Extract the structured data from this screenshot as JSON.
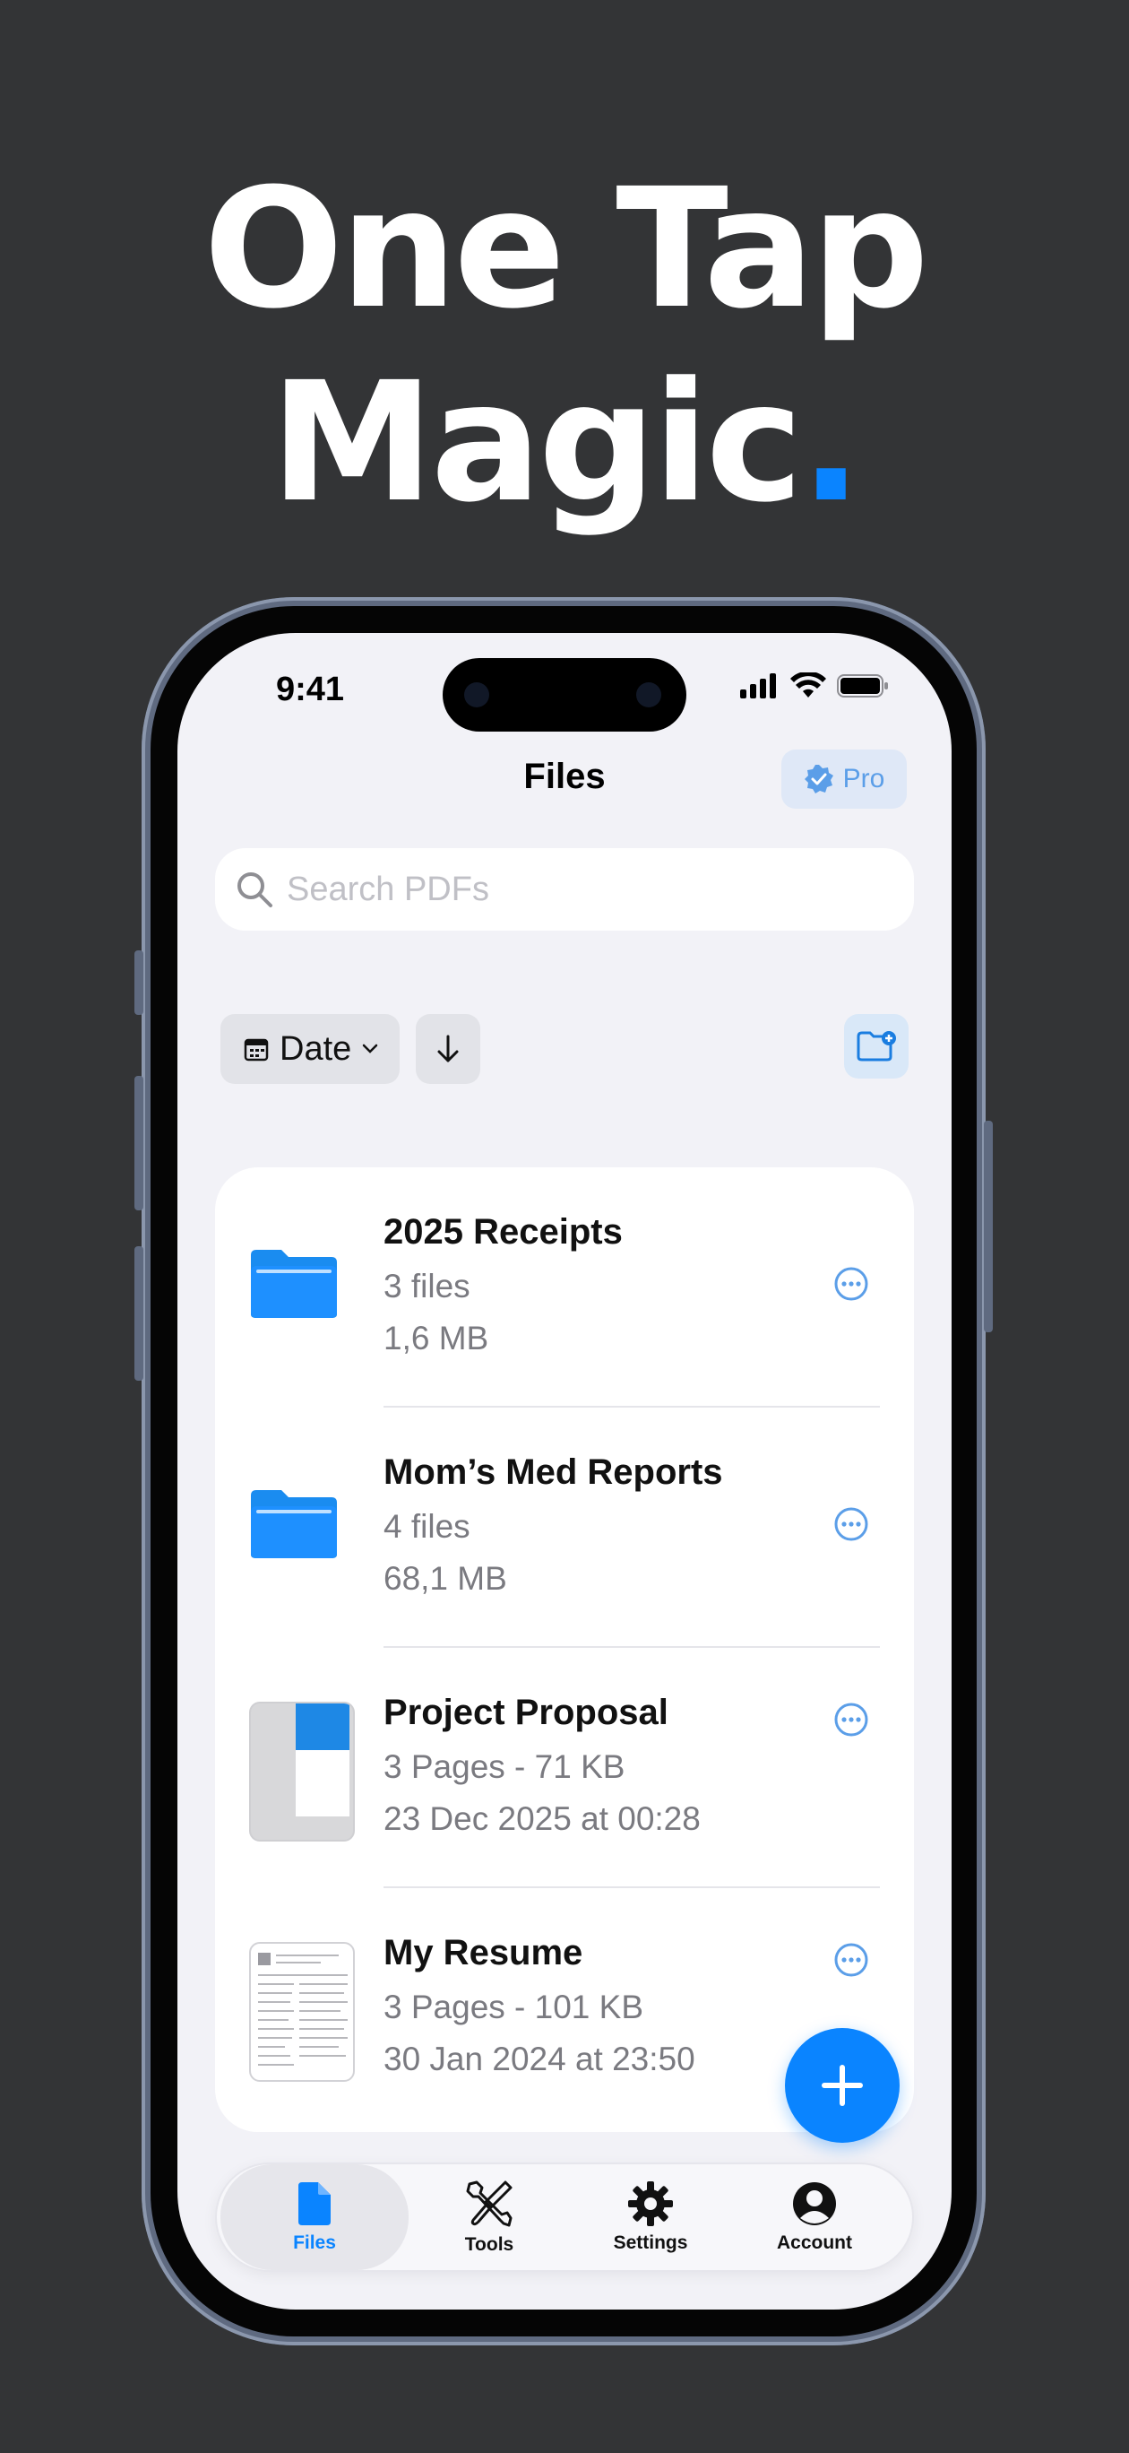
{
  "headline": {
    "line1": "One Tap",
    "line2": "Magic",
    "dot": "."
  },
  "status": {
    "time": "9:41"
  },
  "nav": {
    "title": "Files",
    "pro_label": "Pro"
  },
  "search": {
    "placeholder": "Search PDFs"
  },
  "sort": {
    "label": "Date"
  },
  "files": [
    {
      "title": "2025 Receipts",
      "meta1": "3 files",
      "meta2": "1,6 MB",
      "type": "folder-icon"
    },
    {
      "title": "Mom’s Med Reports",
      "meta1": "4 files",
      "meta2": "68,1 MB",
      "type": "folder-icon"
    },
    {
      "title": "Project Proposal",
      "meta1": "3 Pages - 71 KB",
      "meta2": "23 Dec 2025 at 00:28",
      "type": "pdf-thumbnail"
    },
    {
      "title": "My Resume",
      "meta1": "3 Pages - 101 KB",
      "meta2": "30 Jan 2024 at 23:50",
      "type": "pdf-thumbnail"
    }
  ],
  "tabs": [
    {
      "label": "Files",
      "icon": "document-icon",
      "active": true
    },
    {
      "label": "Tools",
      "icon": "tools-icon",
      "active": false
    },
    {
      "label": "Settings",
      "icon": "gear-icon",
      "active": false
    },
    {
      "label": "Account",
      "icon": "person-circle-icon",
      "active": false
    }
  ],
  "colors": {
    "accent": "#0a84ff",
    "background": "#333436",
    "screen": "#f2f2f7"
  }
}
